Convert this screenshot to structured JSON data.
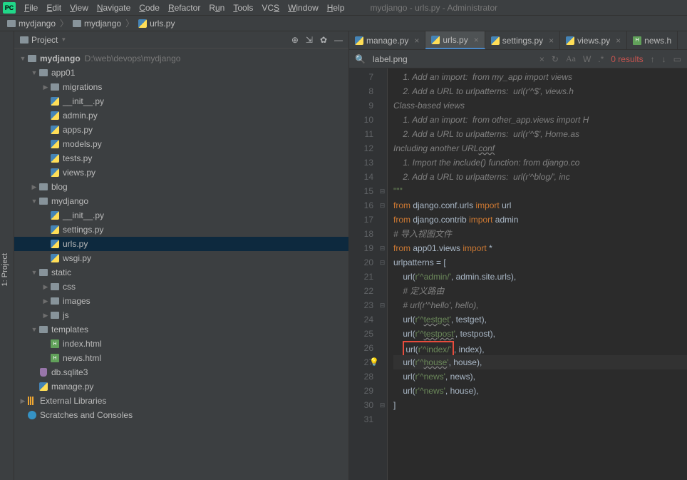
{
  "window_title": "mydjango - urls.py - Administrator",
  "menu": [
    "File",
    "Edit",
    "View",
    "Navigate",
    "Code",
    "Refactor",
    "Run",
    "Tools",
    "VCS",
    "Window",
    "Help"
  ],
  "breadcrumb": {
    "root": "mydjango",
    "mid": "mydjango",
    "file": "urls.py"
  },
  "left_tab": "1: Project",
  "panel": {
    "title": "Project"
  },
  "project_root": {
    "name": "mydjango",
    "path": "D:\\web\\devops\\mydjango"
  },
  "tree": {
    "app01": "app01",
    "migrations": "migrations",
    "init": "__init__.py",
    "admin": "admin.py",
    "apps": "apps.py",
    "models": "models.py",
    "tests": "tests.py",
    "views": "views.py",
    "blog": "blog",
    "mydjango": "mydjango",
    "init2": "__init__.py",
    "settings": "settings.py",
    "urls": "urls.py",
    "wsgi": "wsgi.py",
    "static": "static",
    "css": "css",
    "images": "images",
    "js": "js",
    "templates": "templates",
    "indexhtml": "index.html",
    "newshtml": "news.html",
    "dbsqlite": "db.sqlite3",
    "managepy": "manage.py",
    "extlib": "External Libraries",
    "scratch": "Scratches and Consoles"
  },
  "tabs": {
    "manage": "manage.py",
    "urls": "urls.py",
    "settings": "settings.py",
    "views": "views.py",
    "news": "news.h"
  },
  "find": {
    "query": "label.png",
    "results": "0 results"
  },
  "code": {
    "l7": "    1. Add an import:  from my_app import views",
    "l8": "    2. Add a URL to urlpatterns:  url(r'^$', views.h",
    "l9": "Class-based views",
    "l10": "    1. Add an import:  from other_app.views import H",
    "l11": "    2. Add a URL to urlpatterns:  url(r'^$', Home.as",
    "l12": "Including another URLconf",
    "l13": "    1. Import the include() function: from django.co",
    "l14": "    2. Add a URL to urlpatterns:  url(r'^blog/', inc",
    "l15": "\"\"\"",
    "l16a": "from ",
    "l16b": "django.conf.urls ",
    "l16c": "import ",
    "l16d": "url",
    "l17a": "from ",
    "l17b": "django.contrib ",
    "l17c": "import ",
    "l17d": "admin",
    "l18": "# 导入视图文件",
    "l19a": "from ",
    "l19b": "app01.views ",
    "l19c": "import ",
    "l19d": "*",
    "l20a": "urlpatterns = [",
    "l21a": "    url(",
    "l21b": "r'^admin/'",
    "l21c": ", admin.site.urls),",
    "l22": "    # 定义路由",
    "l23": "    # url(r'^hello', hello),",
    "l24a": "    url(",
    "l24b": "r'^",
    "l24c": "testget",
    "l24d": "'",
    "l24e": ", testget),",
    "l25a": "    url(",
    "l25b": "r'^",
    "l25c": "testpost",
    "l25d": "'",
    "l25e": ", testpost),",
    "l26a": "url(",
    "l26b": "r'^index/'",
    "l26c": ", index),",
    "l27a": "    url(",
    "l27b": "r'^",
    "l27c": "house",
    "l27d": "'",
    "l27e": ", house),",
    "l28a": "    url(",
    "l28b": "r'^news'",
    "l28c": ", news),",
    "l29a": "    url(",
    "l29b": "r'^news'",
    "l29c": ", house),",
    "l30": "]"
  },
  "line_numbers": [
    "7",
    "8",
    "9",
    "10",
    "11",
    "12",
    "13",
    "14",
    "15",
    "16",
    "17",
    "18",
    "19",
    "20",
    "21",
    "22",
    "23",
    "24",
    "25",
    "26",
    "27",
    "28",
    "29",
    "30",
    "31"
  ]
}
